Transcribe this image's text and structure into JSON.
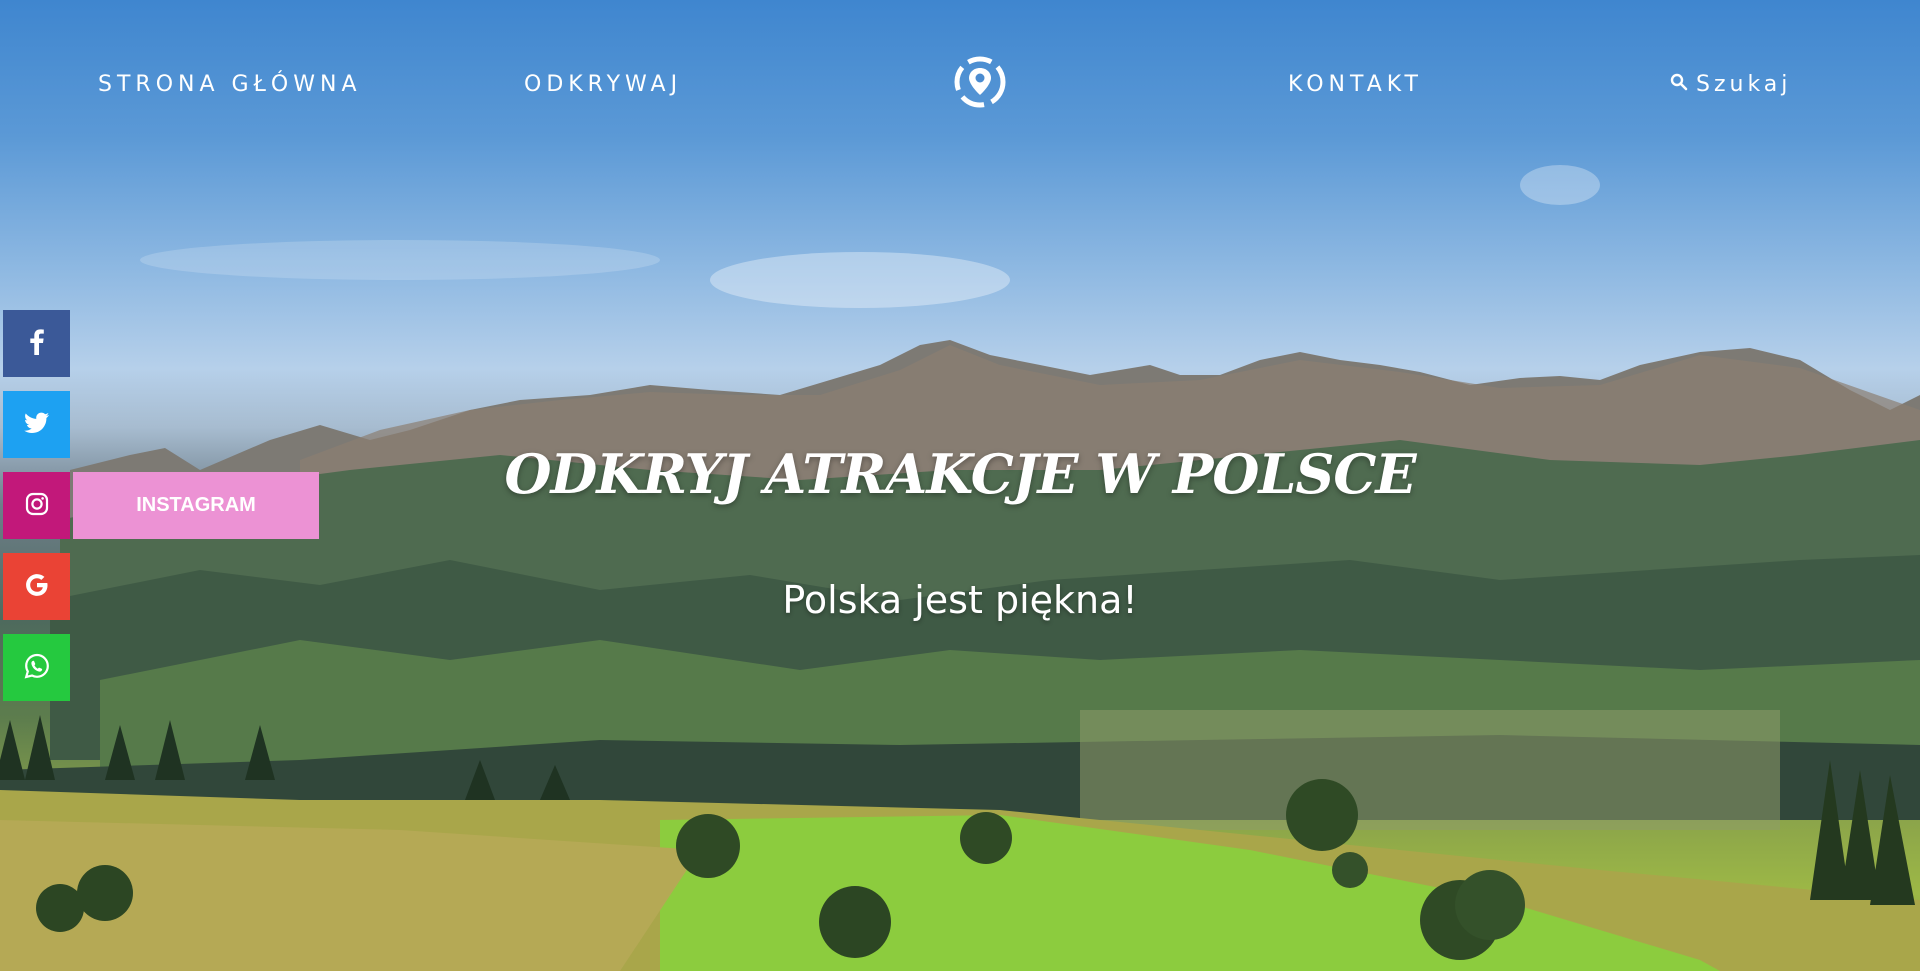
{
  "nav": {
    "home_label": "STRONA GŁÓWNA",
    "explore_label": "ODKRYWAJ",
    "contact_label": "KONTAKT",
    "search_label": "Szukaj",
    "logo_icon": "location-pin-icon",
    "search_icon": "search-icon"
  },
  "hero": {
    "title": "ODKRYJ ATRAKCJE W POLSCE",
    "subtitle": "Polska jest piękna!"
  },
  "social": {
    "items": [
      {
        "name": "facebook",
        "icon": "facebook-icon",
        "color": "#3b5998"
      },
      {
        "name": "twitter",
        "icon": "twitter-icon",
        "color": "#1da1f2"
      },
      {
        "name": "instagram",
        "icon": "instagram-icon",
        "color": "#c2187a"
      },
      {
        "name": "google",
        "icon": "google-icon",
        "color": "#ea4335"
      },
      {
        "name": "whatsapp",
        "icon": "whatsapp-icon",
        "color": "#25c93f"
      }
    ],
    "instagram_label": "INSTAGRAM",
    "instagram_label_color": "#ec92d4"
  }
}
